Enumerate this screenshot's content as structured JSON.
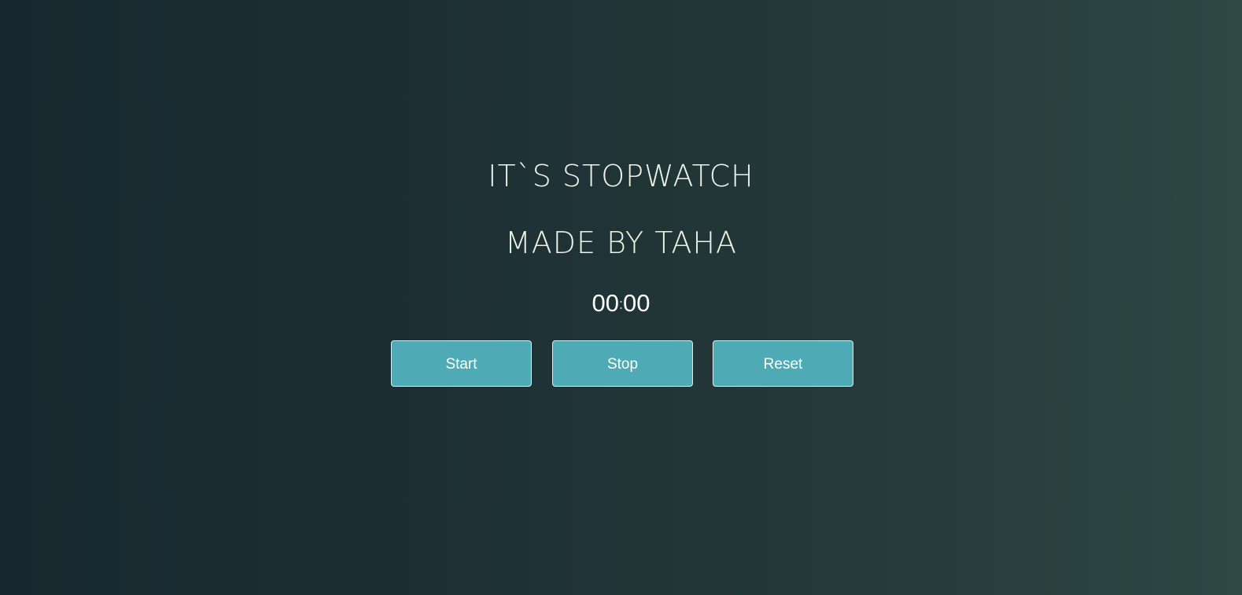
{
  "header": {
    "title": "IT`S STOPWATCH",
    "subtitle": "MADE BY TAHA"
  },
  "timer": {
    "minutes": "00",
    "separator": ":",
    "seconds": "00"
  },
  "controls": {
    "start_label": "Start",
    "stop_label": "Stop",
    "reset_label": "Reset"
  },
  "colors": {
    "background_start": "#172830",
    "background_end": "#2e4844",
    "button": "#4eabb6",
    "text": "#eef3e6"
  }
}
